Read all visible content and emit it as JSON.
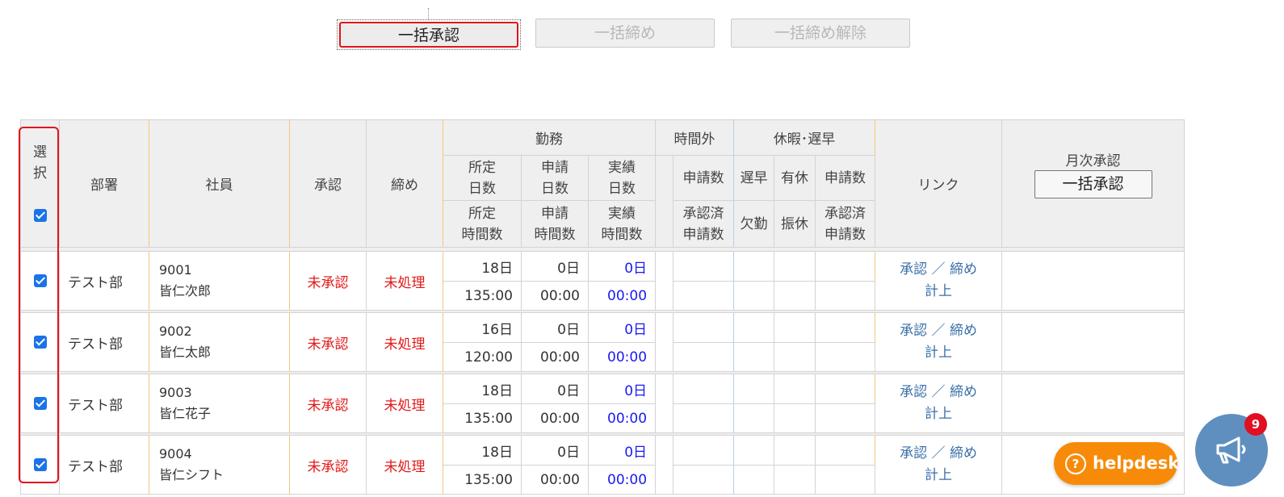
{
  "toolbar": {
    "bulk_approve": "一括承認",
    "bulk_close": "一括締め",
    "bulk_close_release": "一括締め解除"
  },
  "table": {
    "headers": {
      "select_1": "選",
      "select_2": "択",
      "department": "部署",
      "employee": "社員",
      "approval": "承認",
      "close": "締め",
      "work": "勤務",
      "scheduled_days_1": "所定",
      "scheduled_days_2": "日数",
      "applied_days_1": "申請",
      "applied_days_2": "日数",
      "actual_days_1": "実績",
      "actual_days_2": "日数",
      "scheduled_hours_1": "所定",
      "scheduled_hours_2": "時間数",
      "applied_hours_1": "申請",
      "applied_hours_2": "時間数",
      "actual_hours_1": "実績",
      "actual_hours_2": "時間数",
      "overtime": "時間外",
      "ot_applications": "申請数",
      "ot_approved_1": "承認済",
      "ot_approved_2": "申請数",
      "leave_late": "休暇･遅早",
      "late_early": "遅早",
      "paid_leave": "有休",
      "leave_applications": "申請数",
      "absence": "欠勤",
      "substitute_holiday": "振休",
      "leave_approved_1": "承認済",
      "leave_approved_2": "申請数",
      "link": "リンク",
      "monthly_approval": "月次承認",
      "monthly_bulk_approve": "一括承認"
    },
    "rows": [
      {
        "dept": "テスト部",
        "emp_id": "9001",
        "emp_name": "皆仁次郎",
        "approval": "未承認",
        "close": "未処理",
        "sched_days": "18日",
        "applied_days": "0日",
        "actual_days": "0日",
        "sched_hours": "135:00",
        "applied_hours": "00:00",
        "actual_hours": "00:00",
        "link_approve": "承認",
        "link_sep": "／",
        "link_close": "締め",
        "link_record": "計上"
      },
      {
        "dept": "テスト部",
        "emp_id": "9002",
        "emp_name": "皆仁太郎",
        "approval": "未承認",
        "close": "未処理",
        "sched_days": "16日",
        "applied_days": "0日",
        "actual_days": "0日",
        "sched_hours": "120:00",
        "applied_hours": "00:00",
        "actual_hours": "00:00",
        "link_approve": "承認",
        "link_sep": "／",
        "link_close": "締め",
        "link_record": "計上"
      },
      {
        "dept": "テスト部",
        "emp_id": "9003",
        "emp_name": "皆仁花子",
        "approval": "未承認",
        "close": "未処理",
        "sched_days": "18日",
        "applied_days": "0日",
        "actual_days": "0日",
        "sched_hours": "135:00",
        "applied_hours": "00:00",
        "actual_hours": "00:00",
        "link_approve": "承認",
        "link_sep": "／",
        "link_close": "締め",
        "link_record": "計上"
      },
      {
        "dept": "テスト部",
        "emp_id": "9004",
        "emp_name": "皆仁シフト",
        "approval": "未承認",
        "close": "未処理",
        "sched_days": "18日",
        "applied_days": "0日",
        "actual_days": "0日",
        "sched_hours": "135:00",
        "applied_hours": "00:00",
        "actual_hours": "00:00",
        "link_approve": "承認",
        "link_sep": "／",
        "link_close": "締め",
        "link_record": "計上"
      }
    ]
  },
  "helpdesk": {
    "label": "helpdesk",
    "icon": "question-circle-icon"
  },
  "announcements": {
    "badge_count": "9",
    "icon": "megaphone-icon"
  },
  "colors": {
    "accent_red": "#e2141d",
    "status_red": "#e11818",
    "value_blue": "#1a1aee",
    "link_blue": "#3a6fa8",
    "helpdesk_orange": "#f78b09",
    "announce_blue": "#5f8fbf",
    "checkbox_blue": "#1a73e8"
  }
}
